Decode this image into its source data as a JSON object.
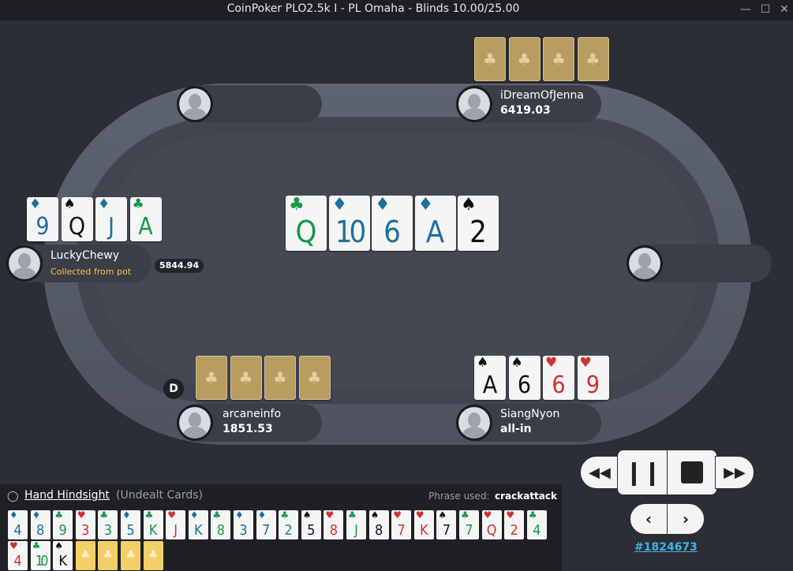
{
  "window": {
    "title": "CoinPoker PLO2.5k I - PL Omaha - Blinds 10.00/25.00",
    "minimize_icon": "minimize-icon",
    "maximize_icon": "maximize-icon",
    "close_icon": "close-icon"
  },
  "board": [
    {
      "rank": "Q",
      "suit": "clubs"
    },
    {
      "rank": "10",
      "suit": "diamonds"
    },
    {
      "rank": "6",
      "suit": "diamonds"
    },
    {
      "rank": "A",
      "suit": "diamonds"
    },
    {
      "rank": "2",
      "suit": "spades"
    }
  ],
  "seats": [
    {
      "name": "iDreamOfJenna",
      "stack": "6419.03",
      "status": "",
      "cards": "hidden"
    },
    {
      "name": "LuckyChewy",
      "stack": "",
      "status": "Collected from pot",
      "chips": "5844.94",
      "cards": [
        {
          "rank": "9",
          "suit": "diamonds"
        },
        {
          "rank": "Q",
          "suit": "spades"
        },
        {
          "rank": "J",
          "suit": "diamonds"
        },
        {
          "rank": "A",
          "suit": "clubs"
        }
      ]
    },
    {
      "name": "arcaneinfo",
      "stack": "1851.53",
      "status": "",
      "cards": "hidden"
    },
    {
      "name": "SiangNyon",
      "stack": "all-in",
      "status": "",
      "cards": [
        {
          "rank": "A",
          "suit": "spades"
        },
        {
          "rank": "6",
          "suit": "spades"
        },
        {
          "rank": "6",
          "suit": "hearts"
        },
        {
          "rank": "9",
          "suit": "hearts"
        }
      ]
    }
  ],
  "dealer_button": "D",
  "colors": {
    "diamonds": "#1d6fa0",
    "spades": "#111111",
    "clubs": "#149a48",
    "hearts": "#d03131",
    "link": "#3eb3e4",
    "status": "#f5c542"
  },
  "replay": {
    "rewind_icon": "rewind-icon",
    "pause_icon": "pause-icon",
    "stop_icon": "stop-icon",
    "fast_forward_icon": "fast-forward-icon",
    "prev_icon": "chevron-left-icon",
    "next_icon": "chevron-right-icon",
    "hand_id": "#1824673"
  },
  "hindsight": {
    "title": "Hand Hindsight",
    "subtitle": "(Undealt Cards)",
    "phrase_label": "Phrase used:",
    "phrase": "crackattack",
    "row1": [
      {
        "rank": "4",
        "suit": "diamonds"
      },
      {
        "rank": "8",
        "suit": "diamonds"
      },
      {
        "rank": "9",
        "suit": "clubs"
      },
      {
        "rank": "3",
        "suit": "hearts"
      },
      {
        "rank": "3",
        "suit": "clubs"
      },
      {
        "rank": "5",
        "suit": "diamonds"
      },
      {
        "rank": "K",
        "suit": "clubs"
      },
      {
        "rank": "J",
        "suit": "hearts"
      },
      {
        "rank": "K",
        "suit": "diamonds"
      },
      {
        "rank": "8",
        "suit": "clubs"
      },
      {
        "rank": "3",
        "suit": "diamonds"
      },
      {
        "rank": "7",
        "suit": "diamonds"
      },
      {
        "rank": "2",
        "suit": "clubs"
      },
      {
        "rank": "5",
        "suit": "spades"
      },
      {
        "rank": "8",
        "suit": "hearts"
      },
      {
        "rank": "J",
        "suit": "clubs"
      },
      {
        "rank": "8",
        "suit": "spades"
      },
      {
        "rank": "7",
        "suit": "hearts"
      },
      {
        "rank": "K",
        "suit": "hearts"
      },
      {
        "rank": "7",
        "suit": "spades"
      },
      {
        "rank": "7",
        "suit": "clubs"
      },
      {
        "rank": "Q",
        "suit": "hearts"
      },
      {
        "rank": "2",
        "suit": "hearts"
      },
      {
        "rank": "4",
        "suit": "clubs"
      }
    ],
    "row2": [
      {
        "rank": "4",
        "suit": "hearts"
      },
      {
        "rank": "10",
        "suit": "clubs"
      },
      {
        "rank": "K",
        "suit": "spades"
      },
      {
        "back": true
      },
      {
        "back": true
      },
      {
        "back": true
      },
      {
        "back": true
      }
    ]
  }
}
